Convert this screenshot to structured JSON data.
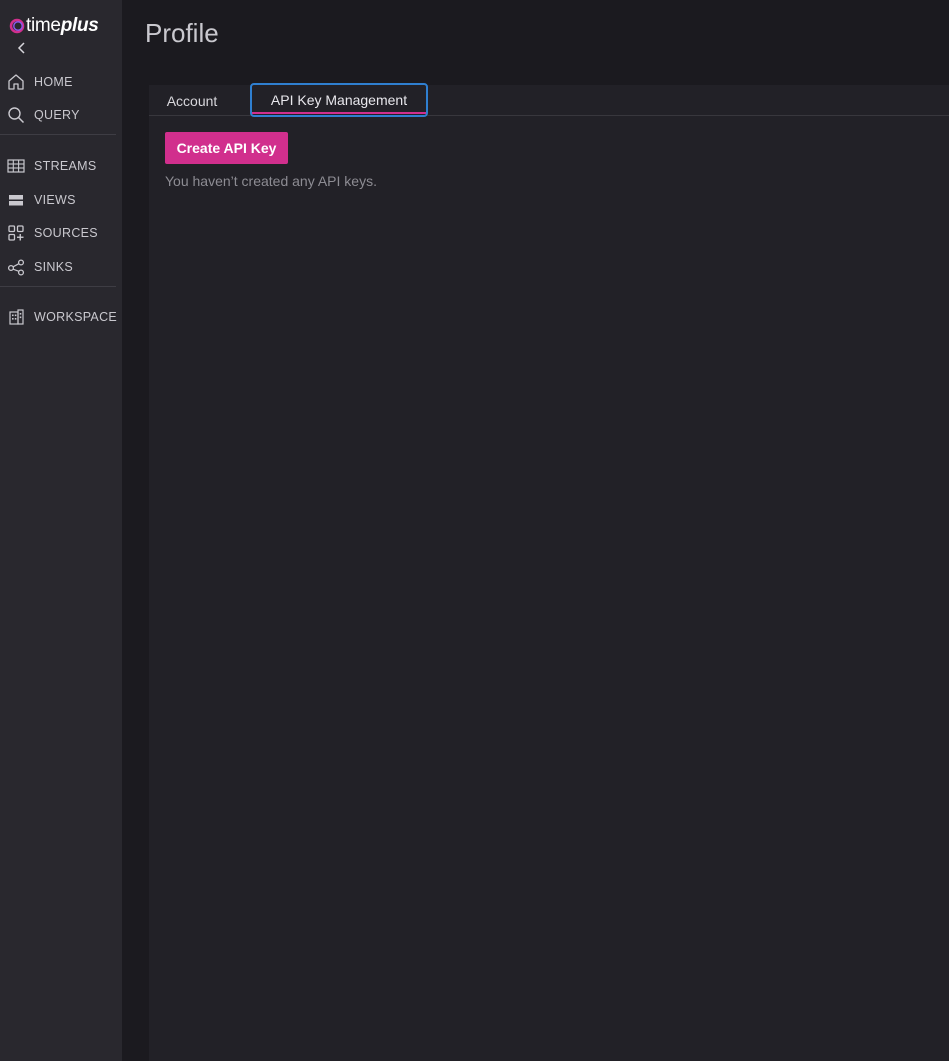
{
  "brand": {
    "logo_text_light": "time",
    "logo_text_bold": "plus",
    "accent_color": "#d12f8d",
    "logo_icon": "timeplus-logo-icon"
  },
  "sidebar": {
    "collapse_icon": "chevron-left-icon",
    "items": [
      {
        "label": "HOME",
        "icon": "home-icon"
      },
      {
        "label": "QUERY",
        "icon": "search-icon"
      },
      {
        "label": "STREAMS",
        "icon": "table-grid-icon"
      },
      {
        "label": "VIEWS",
        "icon": "stacked-layers-icon"
      },
      {
        "label": "SOURCES",
        "icon": "add-blocks-icon"
      },
      {
        "label": "SINKS",
        "icon": "share-nodes-icon"
      },
      {
        "label": "WORKSPACE",
        "icon": "building-icon"
      }
    ]
  },
  "header": {
    "title": "Profile"
  },
  "tabs": [
    {
      "label": "Account",
      "active": false
    },
    {
      "label": "API Key Management",
      "active": true
    }
  ],
  "api_keys": {
    "create_button_label": "Create API Key",
    "empty_message": "You haven’t created any API keys."
  }
}
